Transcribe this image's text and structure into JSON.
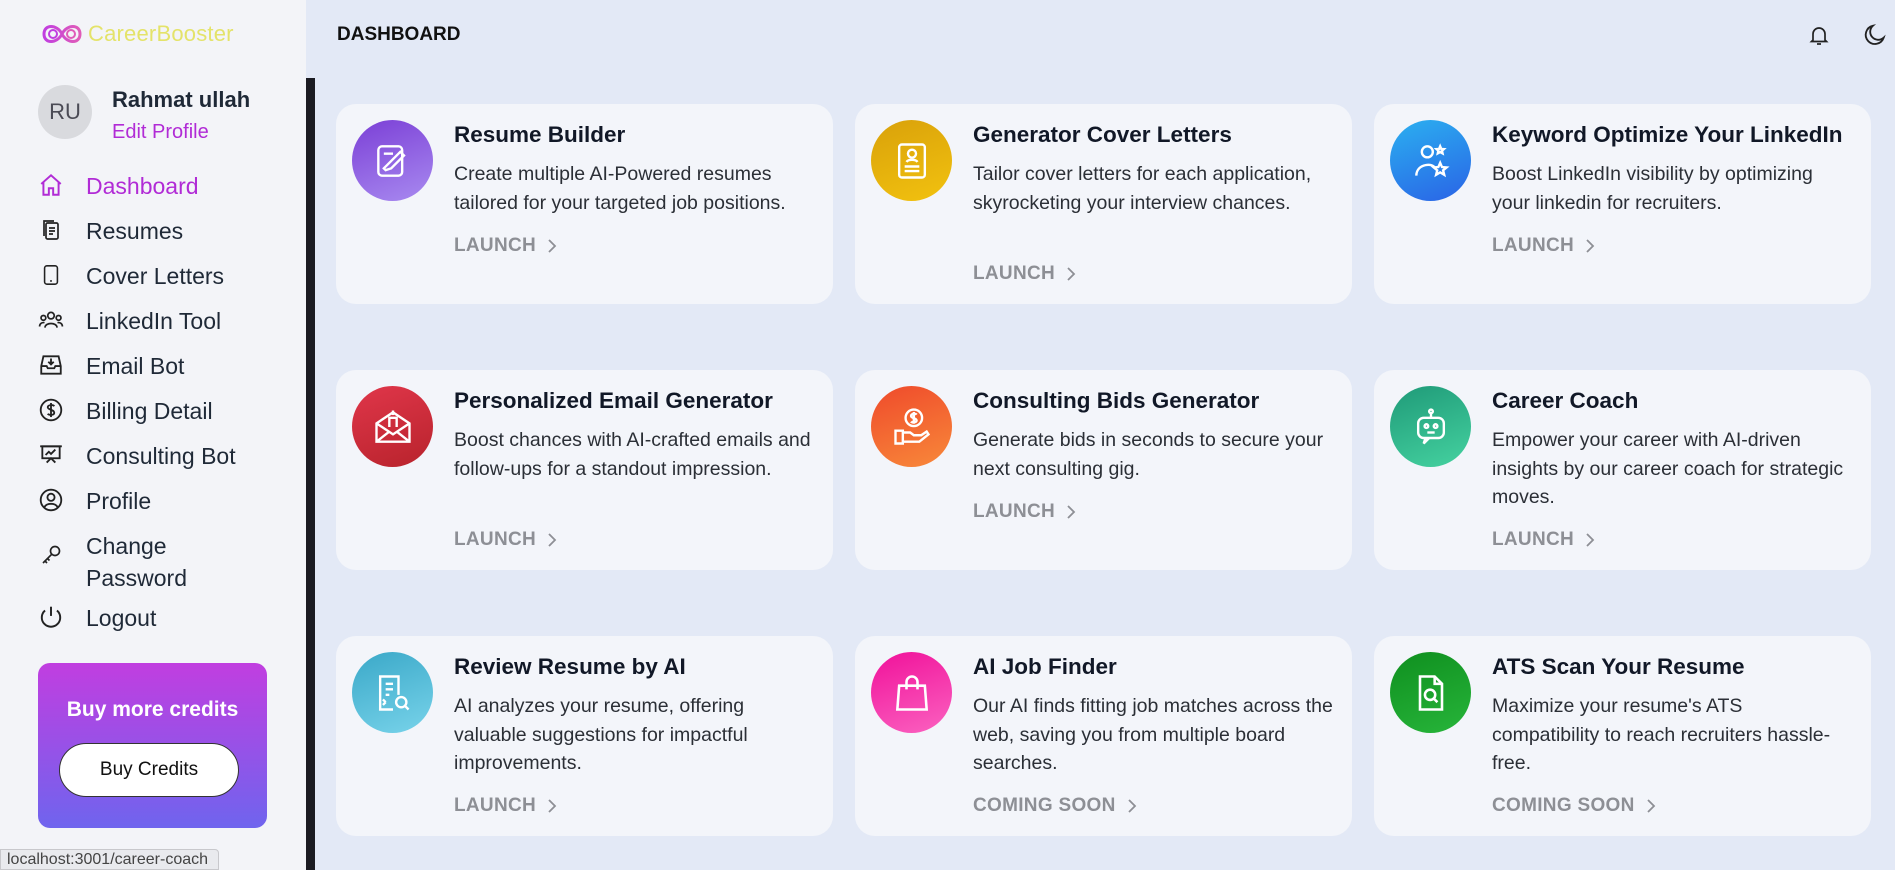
{
  "brand": {
    "name": "CareerBooster"
  },
  "user": {
    "initials": "RU",
    "name": "Rahmat ullah",
    "edit_label": "Edit Profile"
  },
  "nav": [
    {
      "label": "Dashboard",
      "icon": "home-icon",
      "active": true
    },
    {
      "label": "Resumes",
      "icon": "documents-icon"
    },
    {
      "label": "Cover Letters",
      "icon": "tablet-icon"
    },
    {
      "label": "LinkedIn Tool",
      "icon": "users-icon"
    },
    {
      "label": "Email Bot",
      "icon": "inbox-icon"
    },
    {
      "label": "Billing Detail",
      "icon": "dollar-icon"
    },
    {
      "label": "Consulting Bot",
      "icon": "presentation-icon"
    },
    {
      "label": "Profile",
      "icon": "user-circle-icon"
    },
    {
      "label": "Change Password",
      "icon": "key-icon"
    },
    {
      "label": "Logout",
      "icon": "power-icon"
    }
  ],
  "credits": {
    "title": "Buy more credits",
    "button": "Buy Credits"
  },
  "status_url": "localhost:3001/career-coach",
  "header": {
    "title": "DASHBOARD",
    "notifications_icon": "bell-icon",
    "theme_icon": "moon-icon"
  },
  "cards": [
    {
      "title": "Resume Builder",
      "desc": "Create multiple AI-Powered resumes tailored for your targeted job positions.",
      "action": "LAUNCH",
      "icon": "edit-document-icon",
      "colors": [
        "#7b3fd6",
        "#a88af0"
      ]
    },
    {
      "title": "Generator Cover Letters",
      "desc": "Tailor cover letters for each application, skyrocketing your interview chances.",
      "action": "LAUNCH",
      "icon": "cover-letter-icon",
      "colors": [
        "#d9a10a",
        "#f2c20f"
      ]
    },
    {
      "title": "Keyword Optimize Your LinkedIn",
      "desc": "Boost LinkedIn visibility by optimizing your linkedin for recruiters.",
      "action": "LAUNCH",
      "icon": "user-star-icon",
      "colors": [
        "#2bb0f0",
        "#2a63e6"
      ]
    },
    {
      "title": "Personalized Email Generator",
      "desc": "Boost chances with AI-crafted emails and follow-ups for a standout impression.",
      "action": "LAUNCH",
      "icon": "envelope-icon",
      "colors": [
        "#e0364a",
        "#b8232c"
      ]
    },
    {
      "title": "Consulting Bids Generator",
      "desc": "Generate bids in seconds to secure your next consulting gig.",
      "action": "LAUNCH",
      "icon": "money-hand-icon",
      "colors": [
        "#ef4a2b",
        "#f8893a"
      ]
    },
    {
      "title": "Career Coach",
      "desc": "Empower your career with AI-driven insights by our career coach for strategic moves.",
      "action": "LAUNCH",
      "icon": "robot-icon",
      "colors": [
        "#1f9a78",
        "#45d2a0"
      ]
    },
    {
      "title": "Review Resume by AI",
      "desc": "AI analyzes your resume, offering valuable suggestions for impactful improvements.",
      "action": "LAUNCH",
      "icon": "document-search-icon",
      "colors": [
        "#3aa8c8",
        "#78d3ea"
      ]
    },
    {
      "title": "AI Job Finder",
      "desc": "Our AI finds fitting job matches across the web, saving you from multiple board searches.",
      "action": "COMING SOON",
      "icon": "shopping-bag-icon",
      "colors": [
        "#f0119a",
        "#fb62c0"
      ]
    },
    {
      "title": "ATS Scan Your Resume",
      "desc": "Maximize your resume's ATS compatibility to reach recruiters hassle-free.",
      "action": "COMING SOON",
      "icon": "file-search-icon",
      "colors": [
        "#0f8f1f",
        "#27b53a"
      ]
    }
  ],
  "colors": {
    "accent": "#b12bd6",
    "background": "#e3e9f6",
    "card": "#f3f5fa"
  }
}
